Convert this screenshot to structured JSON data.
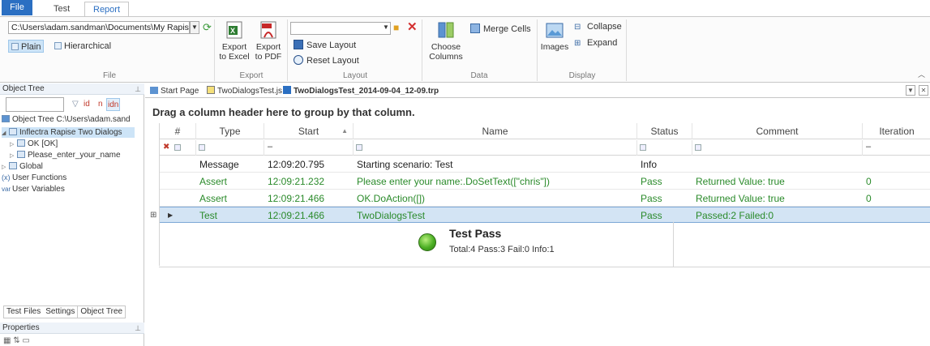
{
  "ribbon_tabs": [
    "File",
    "Test",
    "Report"
  ],
  "file_group": {
    "path": "C:\\Users\\adam.sandman\\Documents\\My Rapis",
    "plain_label": "Plain",
    "hierarchical_label": "Hierarchical",
    "caption": "File"
  },
  "export_group": {
    "excel_label_1": "Export",
    "excel_label_2": "to Excel",
    "pdf_label_1": "Export",
    "pdf_label_2": "to PDF",
    "caption": "Export"
  },
  "layout_group": {
    "save_label": "Save Layout",
    "reset_label": "Reset Layout",
    "caption": "Layout"
  },
  "data_group": {
    "choose_label_1": "Choose",
    "choose_label_2": "Columns",
    "merge_label": "Merge Cells",
    "caption": "Data"
  },
  "display_group": {
    "images_label": "Images",
    "collapse_label": "Collapse",
    "expand_label": "Expand",
    "caption": "Display"
  },
  "object_tree": {
    "title": "Object Tree",
    "pin": "\u0004",
    "filter_id": "id",
    "filter_n": "n",
    "filter_idn": "idn",
    "root": "Object Tree C:\\Users\\adam.sand",
    "items": [
      {
        "label": "Inflectra Rapise Two Dialogs"
      },
      {
        "label": "OK [OK]"
      },
      {
        "label": "Please_enter_your_name"
      },
      {
        "label": "Global"
      },
      {
        "label": "User Functions"
      },
      {
        "label": "User Variables"
      }
    ],
    "bottom_tabs": [
      "Test Files",
      "Settings",
      "Object Tree"
    ]
  },
  "properties": {
    "title": "Properties"
  },
  "doc_tabs": {
    "start_page": "Start Page",
    "script": "TwoDialogsTest.js",
    "report": "TwoDialogsTest_2014-09-04_12-09.trp"
  },
  "group_hint": "Drag a column header here to group by that column.",
  "columns": {
    "num": "#",
    "type": "Type",
    "start": "Start",
    "name": "Name",
    "status": "Status",
    "comment": "Comment",
    "iteration": "Iteration"
  },
  "rows": [
    {
      "type": "Message",
      "start": "12:09:20.795",
      "name": "Starting scenario: Test",
      "status": "Info",
      "comment": "",
      "iteration": ""
    },
    {
      "type": "Assert",
      "start": "12:09:21.232",
      "name": "Please enter your name:.DoSetText([\"chris\"])",
      "status": "Pass",
      "comment": "Returned Value: true",
      "iteration": "0"
    },
    {
      "type": "Assert",
      "start": "12:09:21.466",
      "name": "OK.DoAction([])",
      "status": "Pass",
      "comment": "Returned Value: true",
      "iteration": "0"
    },
    {
      "type": "Test",
      "start": "12:09:21.466",
      "name": "TwoDialogsTest",
      "status": "Pass",
      "comment": "Passed:2 Failed:0",
      "iteration": ""
    }
  ],
  "summary": {
    "title": "Test Pass",
    "detail": "Total:4 Pass:3 Fail:0 Info:1"
  },
  "colors": {
    "accent": "#2b6fc2",
    "pass_green": "#2a8a2a",
    "selection": "#d3e4f4"
  }
}
